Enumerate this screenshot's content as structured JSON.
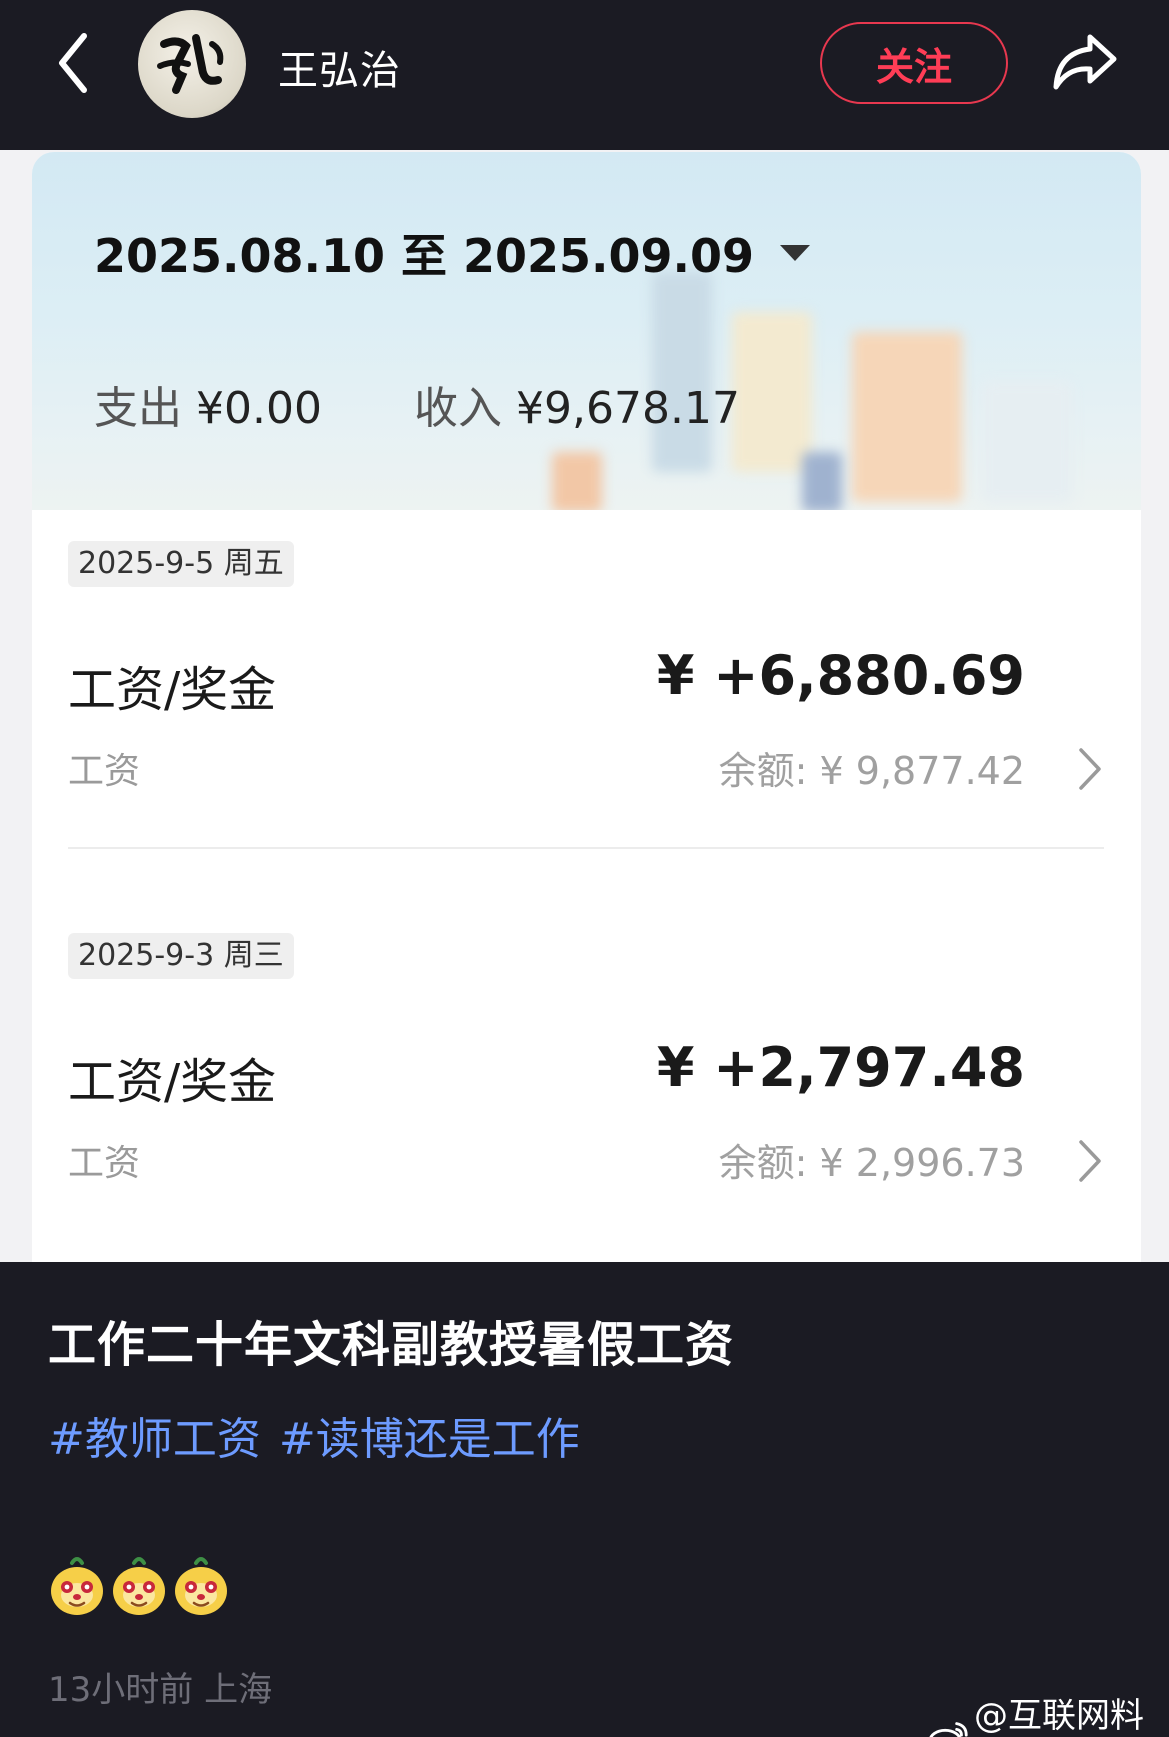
{
  "header": {
    "username": "王弘治",
    "follow_label": "关注"
  },
  "bill": {
    "date_range": "2025.08.10 至 2025.09.09",
    "expense_label": "支出",
    "expense_value": "¥0.00",
    "income_label": "收入",
    "income_value": "¥9,678.17",
    "entries": [
      {
        "date": "2025-9-5 周五",
        "title": "工资/奖金",
        "amount": "¥ +6,880.69",
        "category": "工资",
        "balance": "余额: ¥ 9,877.42"
      },
      {
        "date": "2025-9-3 周三",
        "title": "工资/奖金",
        "amount": "¥ +2,797.48",
        "category": "工资",
        "balance": "余额: ¥ 2,996.73"
      }
    ]
  },
  "post": {
    "title": "工作二十年文科副教授暑假工资",
    "tags": [
      "#教师工资",
      "#读博还是工作"
    ],
    "emoji_icons": [
      "peach-face-icon",
      "peach-face-icon",
      "peach-face-icon"
    ],
    "meta": "13小时前  上海"
  },
  "watermark": "@互联网料哥",
  "colors": {
    "background": "#1b1b23",
    "follow_accent": "#e8384f",
    "tag_link": "#6d9bff",
    "card": "#ffffff"
  }
}
